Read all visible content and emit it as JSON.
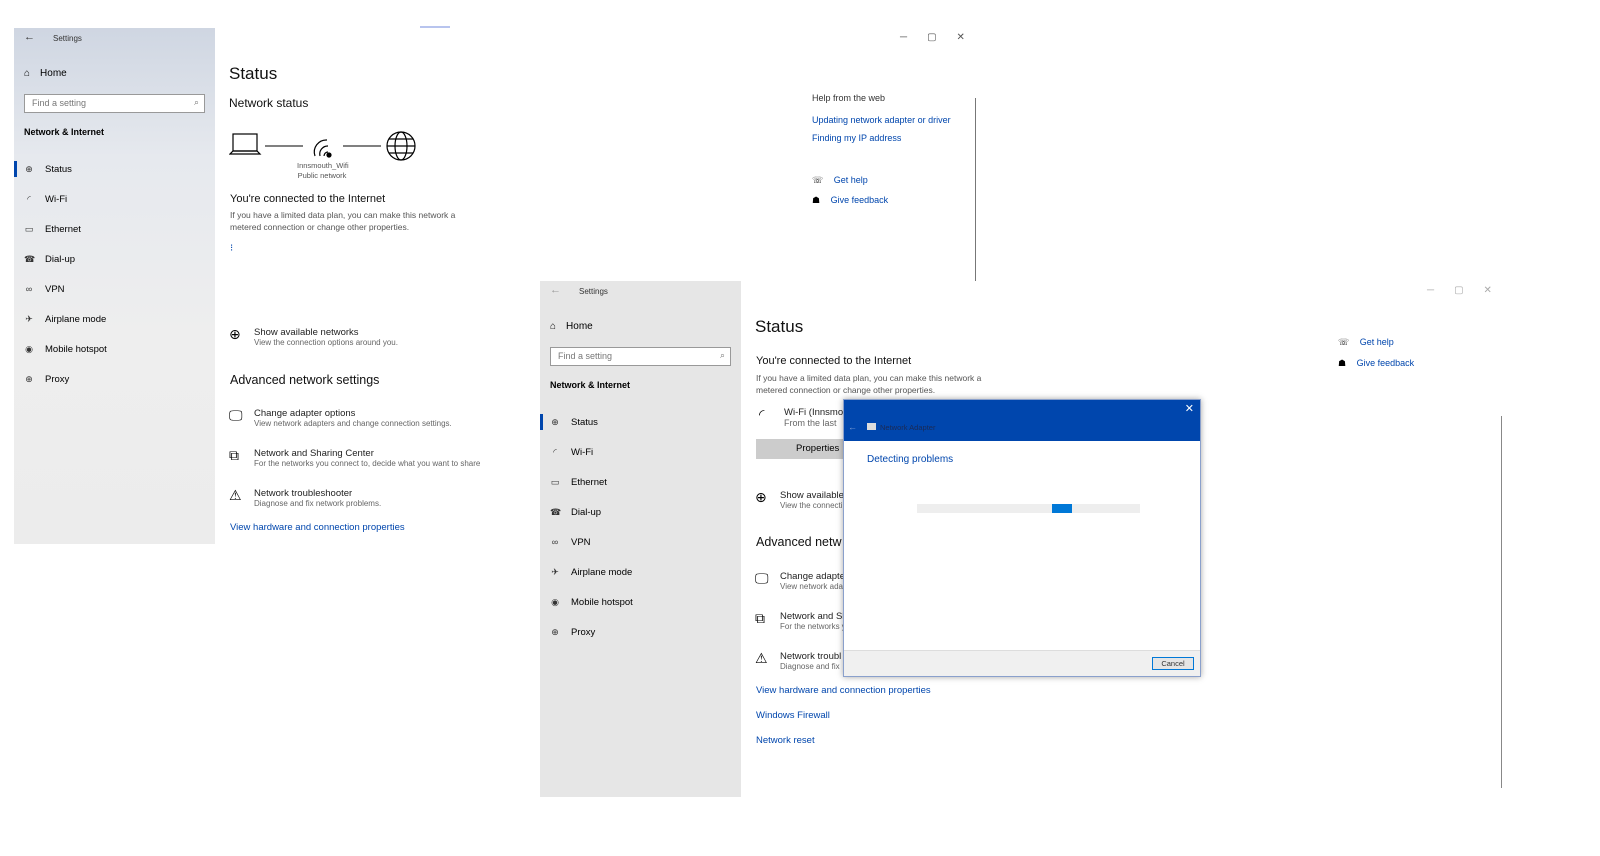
{
  "window1": {
    "title": "Settings",
    "home": "Home",
    "search_placeholder": "Find a setting",
    "section": "Network & Internet",
    "nav": [
      {
        "icon": "status-icon",
        "glyph": "⊕",
        "label": "Status",
        "active": true
      },
      {
        "icon": "wifi-icon",
        "glyph": "◜",
        "label": "Wi-Fi"
      },
      {
        "icon": "ethernet-icon",
        "glyph": "▭",
        "label": "Ethernet"
      },
      {
        "icon": "dialup-icon",
        "glyph": "☎",
        "label": "Dial-up"
      },
      {
        "icon": "vpn-icon",
        "glyph": "∞",
        "label": "VPN"
      },
      {
        "icon": "airplane-icon",
        "glyph": "✈",
        "label": "Airplane mode"
      },
      {
        "icon": "hotspot-icon",
        "glyph": "◉",
        "label": "Mobile hotspot"
      },
      {
        "icon": "proxy-icon",
        "glyph": "⊕",
        "label": "Proxy"
      }
    ],
    "page_title": "Status",
    "network_status": "Network status",
    "network_name": "Innsmouth_Wifi",
    "network_type": "Public network",
    "connected": "You're connected to the Internet",
    "connected_desc1": "If you have a limited data plan, you can make this network a",
    "connected_desc2": "metered connection or change other properties.",
    "show_networks": {
      "title": "Show available networks",
      "sub": "View the connection options around you."
    },
    "advanced_title": "Advanced network settings",
    "advanced": [
      {
        "icon": "adapter-icon",
        "glyph": "🖵",
        "title": "Change adapter options",
        "sub": "View network adapters and change connection settings."
      },
      {
        "icon": "sharing-icon",
        "glyph": "⧉",
        "title": "Network and Sharing Center",
        "sub": "For the networks you connect to, decide what you want to share"
      },
      {
        "icon": "warning-icon",
        "glyph": "⚠",
        "title": "Network troubleshooter",
        "sub": "Diagnose and fix network problems."
      }
    ],
    "hardware_link": "View hardware and connection properties",
    "help_title": "Help from the web",
    "help_links": [
      "Updating network adapter or driver",
      "Finding my IP address"
    ],
    "get_help": "Get help",
    "give_feedback": "Give feedback"
  },
  "window2": {
    "title": "Settings",
    "home": "Home",
    "search_placeholder": "Find a setting",
    "section": "Network & Internet",
    "nav": [
      {
        "icon": "status-icon",
        "glyph": "⊕",
        "label": "Status",
        "active": true
      },
      {
        "icon": "wifi-icon",
        "glyph": "◜",
        "label": "Wi-Fi"
      },
      {
        "icon": "ethernet-icon",
        "glyph": "▭",
        "label": "Ethernet"
      },
      {
        "icon": "dialup-icon",
        "glyph": "☎",
        "label": "Dial-up"
      },
      {
        "icon": "vpn-icon",
        "glyph": "∞",
        "label": "VPN"
      },
      {
        "icon": "airplane-icon",
        "glyph": "✈",
        "label": "Airplane mode"
      },
      {
        "icon": "hotspot-icon",
        "glyph": "◉",
        "label": "Mobile hotspot"
      },
      {
        "icon": "proxy-icon",
        "glyph": "⊕",
        "label": "Proxy"
      }
    ],
    "page_title": "Status",
    "connected": "You're connected to the Internet",
    "connected_desc1": "If you have a limited data plan, you can make this network a",
    "connected_desc2": "metered connection or change other properties.",
    "wifi_title": "Wi-Fi (Innsmo",
    "wifi_sub": "From the last",
    "properties": "Properties",
    "show_networks": {
      "title": "Show available",
      "sub": "View the connecti"
    },
    "advanced_title": "Advanced netw",
    "advanced": [
      {
        "icon": "adapter-icon",
        "glyph": "🖵",
        "title": "Change adapter",
        "sub": "View network ada"
      },
      {
        "icon": "sharing-icon",
        "glyph": "⧉",
        "title": "Network and Sh",
        "sub": "For the networks y"
      },
      {
        "icon": "warning-icon",
        "glyph": "⚠",
        "title": "Network troubl",
        "sub": "Diagnose and fix"
      }
    ],
    "links": [
      "View hardware and connection properties",
      "Windows Firewall",
      "Network reset"
    ],
    "get_help": "Get help",
    "give_feedback": "Give feedback"
  },
  "dialog": {
    "title": "Network Adapter",
    "status": "Detecting problems",
    "progress_position": 0.65,
    "cancel": "Cancel",
    "accent": "#0046ad"
  }
}
